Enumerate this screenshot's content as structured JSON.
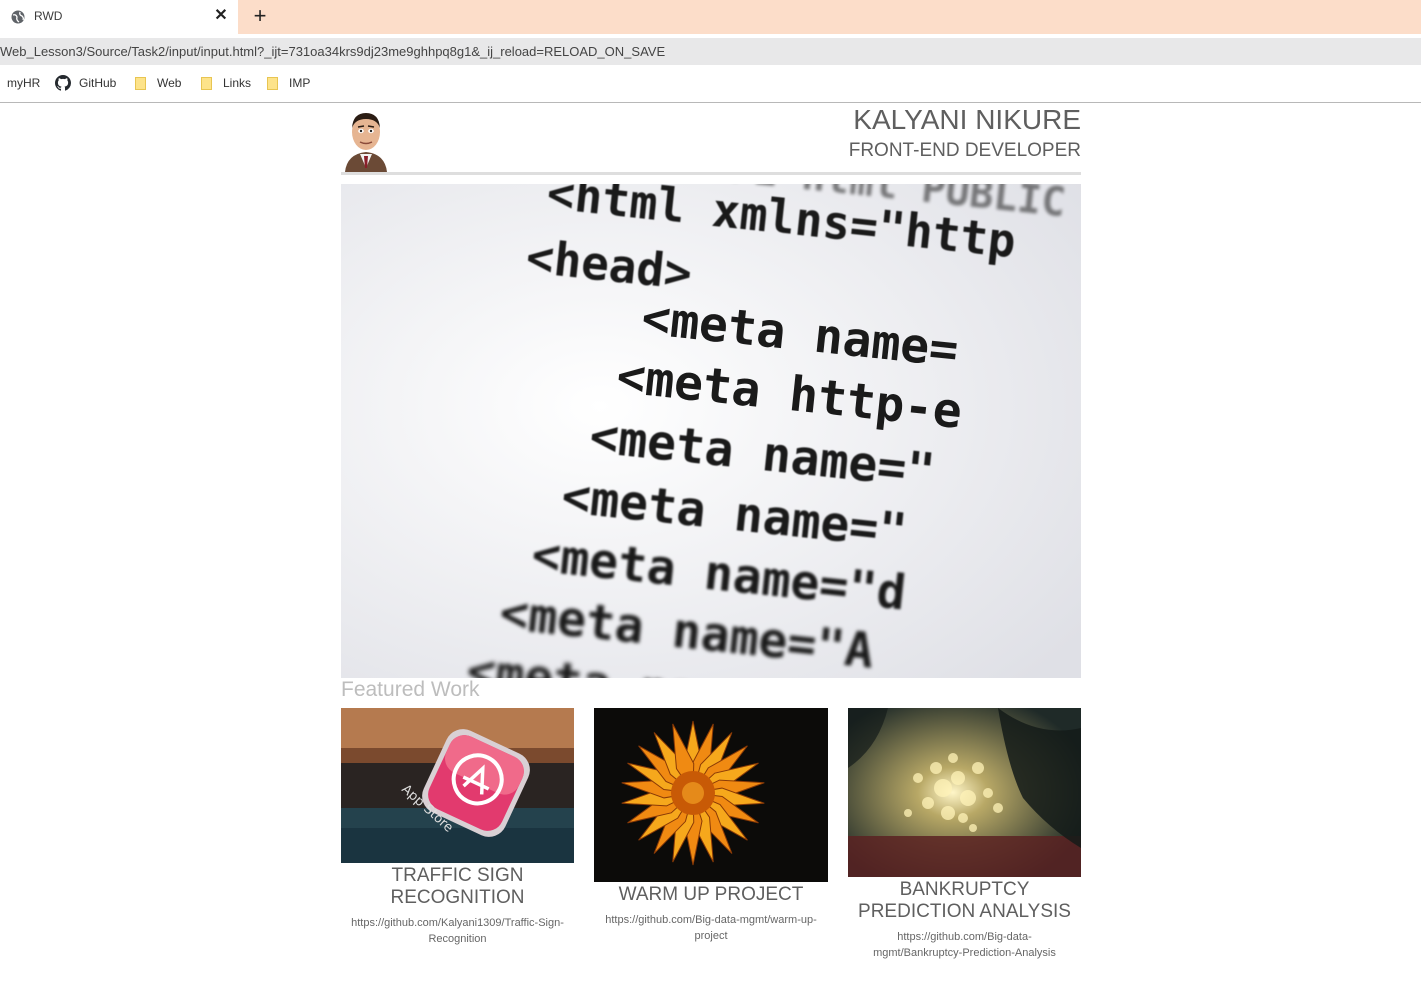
{
  "browser": {
    "tab_title": "RWD",
    "tab_close": "✕",
    "new_tab": "+",
    "url": "Web_Lesson3/Source/Task2/input/input.html?_ijt=731oa34krs9dj23me9ghhpq8g1&_ij_reload=RELOAD_ON_SAVE",
    "bookmarks": [
      {
        "label": "myHR"
      },
      {
        "label": "GitHub",
        "icon": "github-icon"
      },
      {
        "label": "Web",
        "icon": "folder-icon"
      },
      {
        "label": "Links",
        "icon": "folder-icon"
      },
      {
        "label": "IMP",
        "icon": "folder-icon"
      }
    ]
  },
  "header": {
    "name": "KALYANI NIKURE",
    "role": "FRONT-END DEVELOPER"
  },
  "hero": {
    "code_lines": [
      "<!DOCTYPE html PUBLIC",
      "<html xmlns=\"http",
      "<head>",
      "<meta name=",
      "<meta http-e",
      "<meta name=\"",
      "<meta name=\"",
      "<meta name=\"d",
      "<meta name=\"A",
      "<meta name=\"d"
    ]
  },
  "featured": {
    "heading": "Featured Work",
    "items": [
      {
        "title": "TRAFFIC SIGN RECOGNITION",
        "link": "https://github.com/Kalyani1309/Traffic-Sign-Recognition"
      },
      {
        "title": "WARM UP PROJECT",
        "link": "https://github.com/Big-data-mgmt/warm-up-project"
      },
      {
        "title": "BANKRUPTCY PREDICTION ANALYSIS",
        "link": "https://github.com/Big-data-mgmt/Bankruptcy-Prediction-Analysis"
      }
    ]
  },
  "colors": {
    "tabstrip": "#fcddc9",
    "text": "#5f5f5f",
    "featured_heading": "#bdbdbd"
  }
}
